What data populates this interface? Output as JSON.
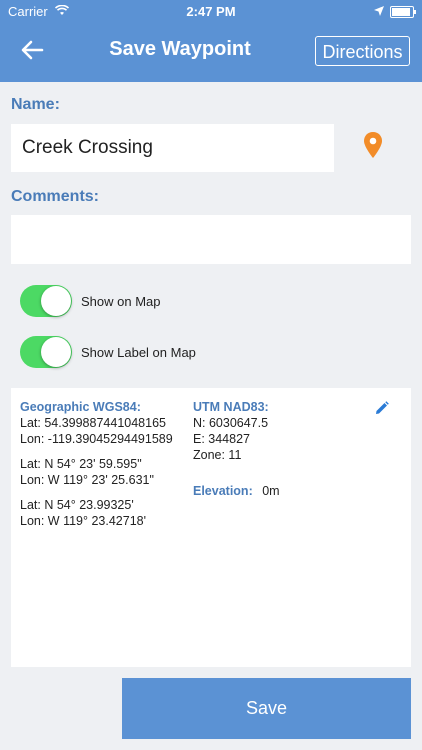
{
  "status_bar": {
    "carrier": "Carrier",
    "time": "2:47 PM"
  },
  "header": {
    "title": "Save Waypoint",
    "directions_label": "Directions"
  },
  "name": {
    "label": "Name:",
    "value": "Creek Crossing"
  },
  "comments": {
    "label": "Comments:",
    "value": ""
  },
  "toggles": [
    {
      "label": "Show on Map",
      "on": true
    },
    {
      "label": "Show Label on Map",
      "on": true
    }
  ],
  "geographic": {
    "title": "Geographic WGS84:",
    "lat_dec": "Lat: 54.399887441048165",
    "lon_dec": "Lon: -119.39045294491589",
    "lat_dms": "Lat: N 54° 23' 59.595\"",
    "lon_dms": "Lon: W 119° 23' 25.631\"",
    "lat_dm": "Lat: N 54° 23.99325'",
    "lon_dm": "Lon: W 119° 23.42718'"
  },
  "utm": {
    "title": "UTM NAD83:",
    "northing": "N: 6030647.5",
    "easting": "E: 344827",
    "zone": "Zone: 11"
  },
  "elevation": {
    "label": "Elevation:",
    "value": "0m"
  },
  "save_label": "Save",
  "colors": {
    "accent": "#5b92d4",
    "label_blue": "#4a7cb8",
    "toggle_on": "#4cd964",
    "pin_orange": "#f28c28"
  }
}
